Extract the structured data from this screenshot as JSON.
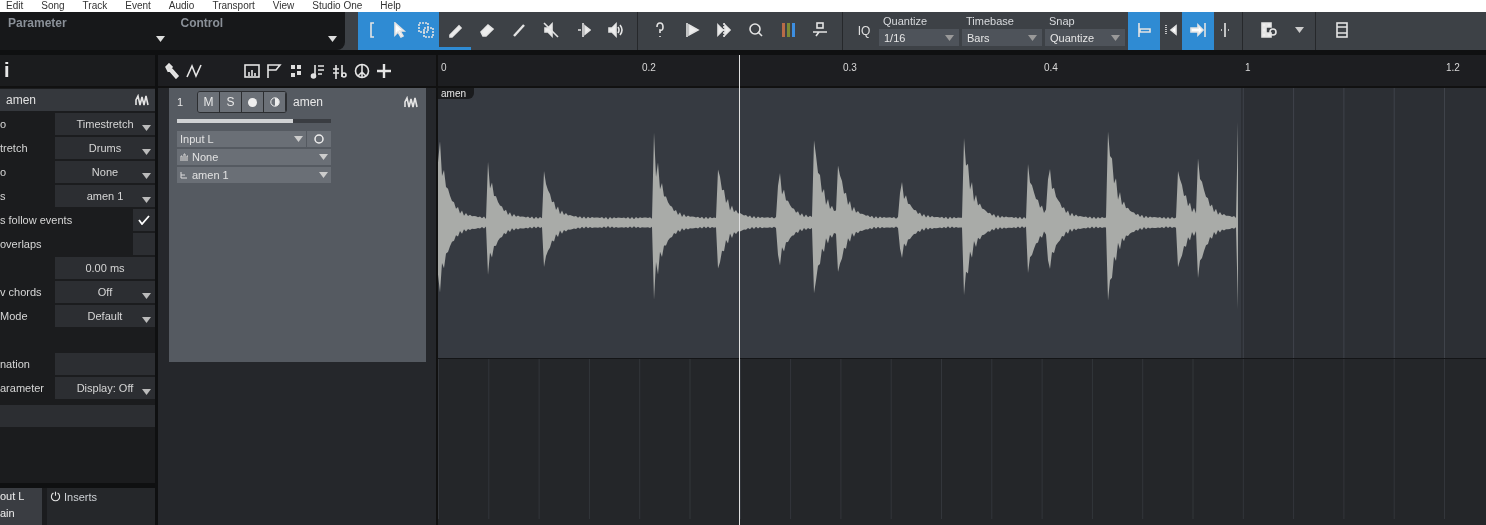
{
  "menu": [
    "Edit",
    "Song",
    "Track",
    "Event",
    "Audio",
    "Transport",
    "View",
    "Studio One",
    "Help"
  ],
  "toolbar": {
    "parameter_label": "Parameter",
    "control_label": "Control",
    "tools": [
      {
        "selected": true
      },
      {
        "selected": true
      },
      {
        "selected": true
      },
      {
        "selected": true
      },
      {
        "selected": false
      },
      {
        "selected": false
      },
      {
        "selected": false
      },
      {
        "selected": false
      },
      {
        "selected": false
      }
    ],
    "iq": "IQ",
    "selectors": [
      {
        "label": "Quantize",
        "value": "1/16"
      },
      {
        "label": "Timebase",
        "value": "Bars"
      },
      {
        "label": "Snap",
        "value": "Quantize"
      }
    ],
    "snap_buttons": [
      {
        "selected": true
      },
      {
        "selected": false
      },
      {
        "selected": true
      },
      {
        "selected": false
      }
    ]
  },
  "inspector": {
    "title": "i",
    "track_name": "amen",
    "rows": [
      {
        "kind": "select",
        "label": "o",
        "value": "Timestretch"
      },
      {
        "kind": "select",
        "label": "tretch",
        "value": "Drums"
      },
      {
        "kind": "select",
        "label": "o",
        "value": "None"
      },
      {
        "kind": "select",
        "label": "s",
        "value": "amen 1"
      },
      {
        "kind": "check",
        "label": "s follow events",
        "checked": true
      },
      {
        "kind": "check",
        "label": "overlaps",
        "checked": false
      },
      {
        "kind": "field",
        "value": "0.00 ms"
      },
      {
        "kind": "select",
        "label": "v chords",
        "value": "Off"
      },
      {
        "kind": "select",
        "label": "Mode",
        "value": "Default"
      },
      {
        "kind": "gap"
      },
      {
        "kind": "field",
        "label": "nation"
      },
      {
        "kind": "select",
        "label": "arameter",
        "value": "Display: Off"
      }
    ],
    "io": [
      "out L",
      "ain"
    ],
    "inserts": "Inserts"
  },
  "track": {
    "number": "1",
    "buttons": [
      "M",
      "S"
    ],
    "monitor_on": false,
    "name": "amen",
    "volume": {
      "level": 0.75
    },
    "input": "Input L",
    "instrument": "None",
    "output": "amen 1"
  },
  "ruler": {
    "ticks": [
      "0",
      "0.2",
      "0.3",
      "0.4",
      "1",
      "1.2"
    ]
  },
  "event": {
    "name": "amen"
  }
}
